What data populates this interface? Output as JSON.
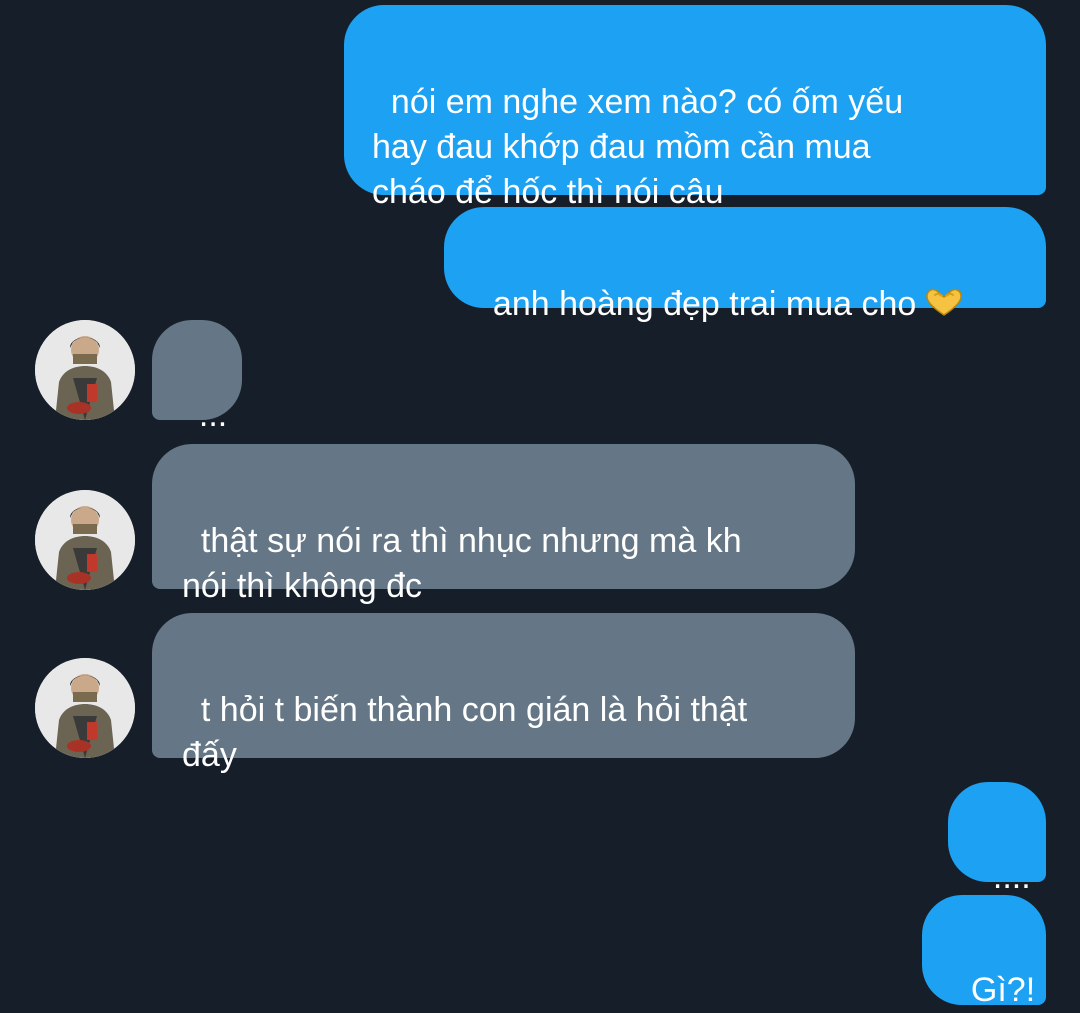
{
  "colors": {
    "background": "#161e29",
    "outgoing_bubble": "#1da1f2",
    "incoming_bubble": "#657786",
    "text": "#ffffff"
  },
  "messages": [
    {
      "direction": "outgoing",
      "text": "nói em nghe xem nào? có ốm yếu\nhay đau khớp đau mồm cần mua\ncháo để hốc thì nói câu"
    },
    {
      "direction": "outgoing",
      "text": "anh hoàng đẹp trai mua cho",
      "emoji": "heart-hands-icon"
    },
    {
      "direction": "incoming",
      "text": "..."
    },
    {
      "direction": "incoming",
      "text": "thật sự nói ra thì nhục nhưng mà kh\nnói thì không đc"
    },
    {
      "direction": "incoming",
      "text": "t hỏi t biến thành con gián là hỏi thật\nđấy"
    },
    {
      "direction": "outgoing",
      "text": "...."
    },
    {
      "direction": "outgoing",
      "text": "Gì?!"
    }
  ]
}
